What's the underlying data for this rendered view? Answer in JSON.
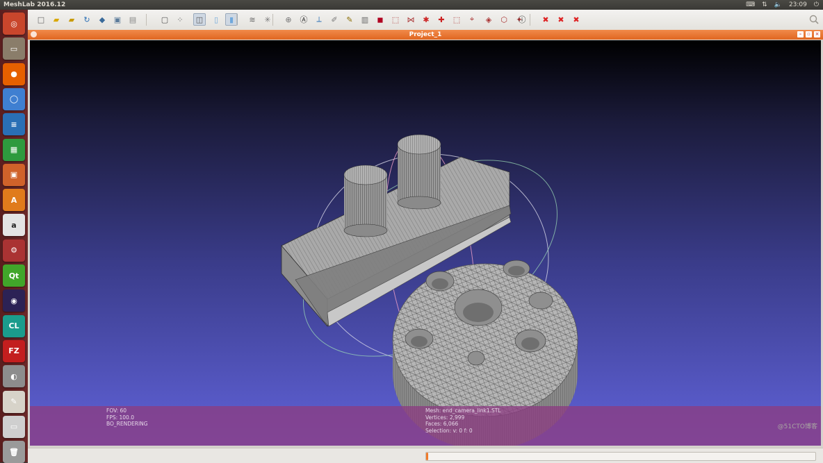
{
  "app_title": "MeshLab 2016.12",
  "clock": "23:09",
  "window_title": "Project_1",
  "launcher_items": [
    {
      "name": "ubuntu-dash-icon",
      "glyph": "◎",
      "color": "#c9462c"
    },
    {
      "name": "files-icon",
      "glyph": "▭",
      "color": "#8a7d6a"
    },
    {
      "name": "firefox-icon",
      "glyph": "●",
      "color": "#e66000"
    },
    {
      "name": "chromium-icon",
      "glyph": "◯",
      "color": "#3f7fd1"
    },
    {
      "name": "writer-icon",
      "glyph": "≡",
      "color": "#2a6fb5"
    },
    {
      "name": "calc-icon",
      "glyph": "▦",
      "color": "#2e9a3e"
    },
    {
      "name": "impress-icon",
      "glyph": "▣",
      "color": "#d0622a"
    },
    {
      "name": "software-center-icon",
      "glyph": "A",
      "color": "#e07b1c"
    },
    {
      "name": "amazon-icon",
      "glyph": "a",
      "color": "#e4e4e4"
    },
    {
      "name": "settings-icon",
      "glyph": "⚙",
      "color": "#a33"
    },
    {
      "name": "qt-creator-icon",
      "glyph": "Qt",
      "color": "#41a62a"
    },
    {
      "name": "eclipse-icon",
      "glyph": "◉",
      "color": "#2c2255"
    },
    {
      "name": "clion-icon",
      "glyph": "CL",
      "color": "#1b9c8c"
    },
    {
      "name": "filezilla-icon",
      "glyph": "FZ",
      "color": "#c31e1e"
    },
    {
      "name": "meshlab-eye-icon",
      "glyph": "◐",
      "color": "#8d8d8d"
    },
    {
      "name": "text-editor-icon",
      "glyph": "✎",
      "color": "#d7d3c9"
    },
    {
      "name": "drive-icon",
      "glyph": "▭",
      "color": "#cfcfcf"
    },
    {
      "name": "trash-icon",
      "glyph": "🗑",
      "color": "#9a9a9a"
    }
  ],
  "toolbar_icons": [
    "new-project-icon",
    "open-project-icon",
    "open-mesh-icon",
    "reload-icon",
    "save-snapshot-icon",
    "import-raster-icon",
    "layers-icon",
    "bbox-icon",
    "points-icon",
    "wireframe-icon",
    "flat-lines-icon",
    "smooth-icon",
    "layer-dialog-icon",
    "rotate-light-icon",
    "align-icon",
    "annotation-icon",
    "measure-icon",
    "pick-points-icon",
    "paint-icon",
    "select-vertex-icon",
    "edit-texture-icon",
    "select-faces-icon",
    "select-connected-icon",
    "select-faces-area-icon",
    "manual-align-icon",
    "georef-icon",
    "select-region-icon",
    "edit-mesh-icon",
    "edit-fragments-icon",
    "edit-points-icon",
    "info-icon",
    "delete-selected-faces-icon",
    "delete-selected-vertices-icon",
    "delete-selection-icon"
  ],
  "viewport": {
    "info_left": [
      "FOV: 60",
      "FPS:   100.0",
      "BO_RENDERING"
    ],
    "info_right": [
      "Mesh: end_camera_link1.STL",
      "Vertices: 2,999",
      "Faces: 6,066",
      "Selection: v: 0 f: 0"
    ]
  },
  "statusbar": {
    "progress": 0.0
  },
  "watermark": "@51CTO博客",
  "colors": {
    "accent": "#e06620",
    "launcher": "#5b1e1e",
    "info_bar": "#8c3c82"
  }
}
